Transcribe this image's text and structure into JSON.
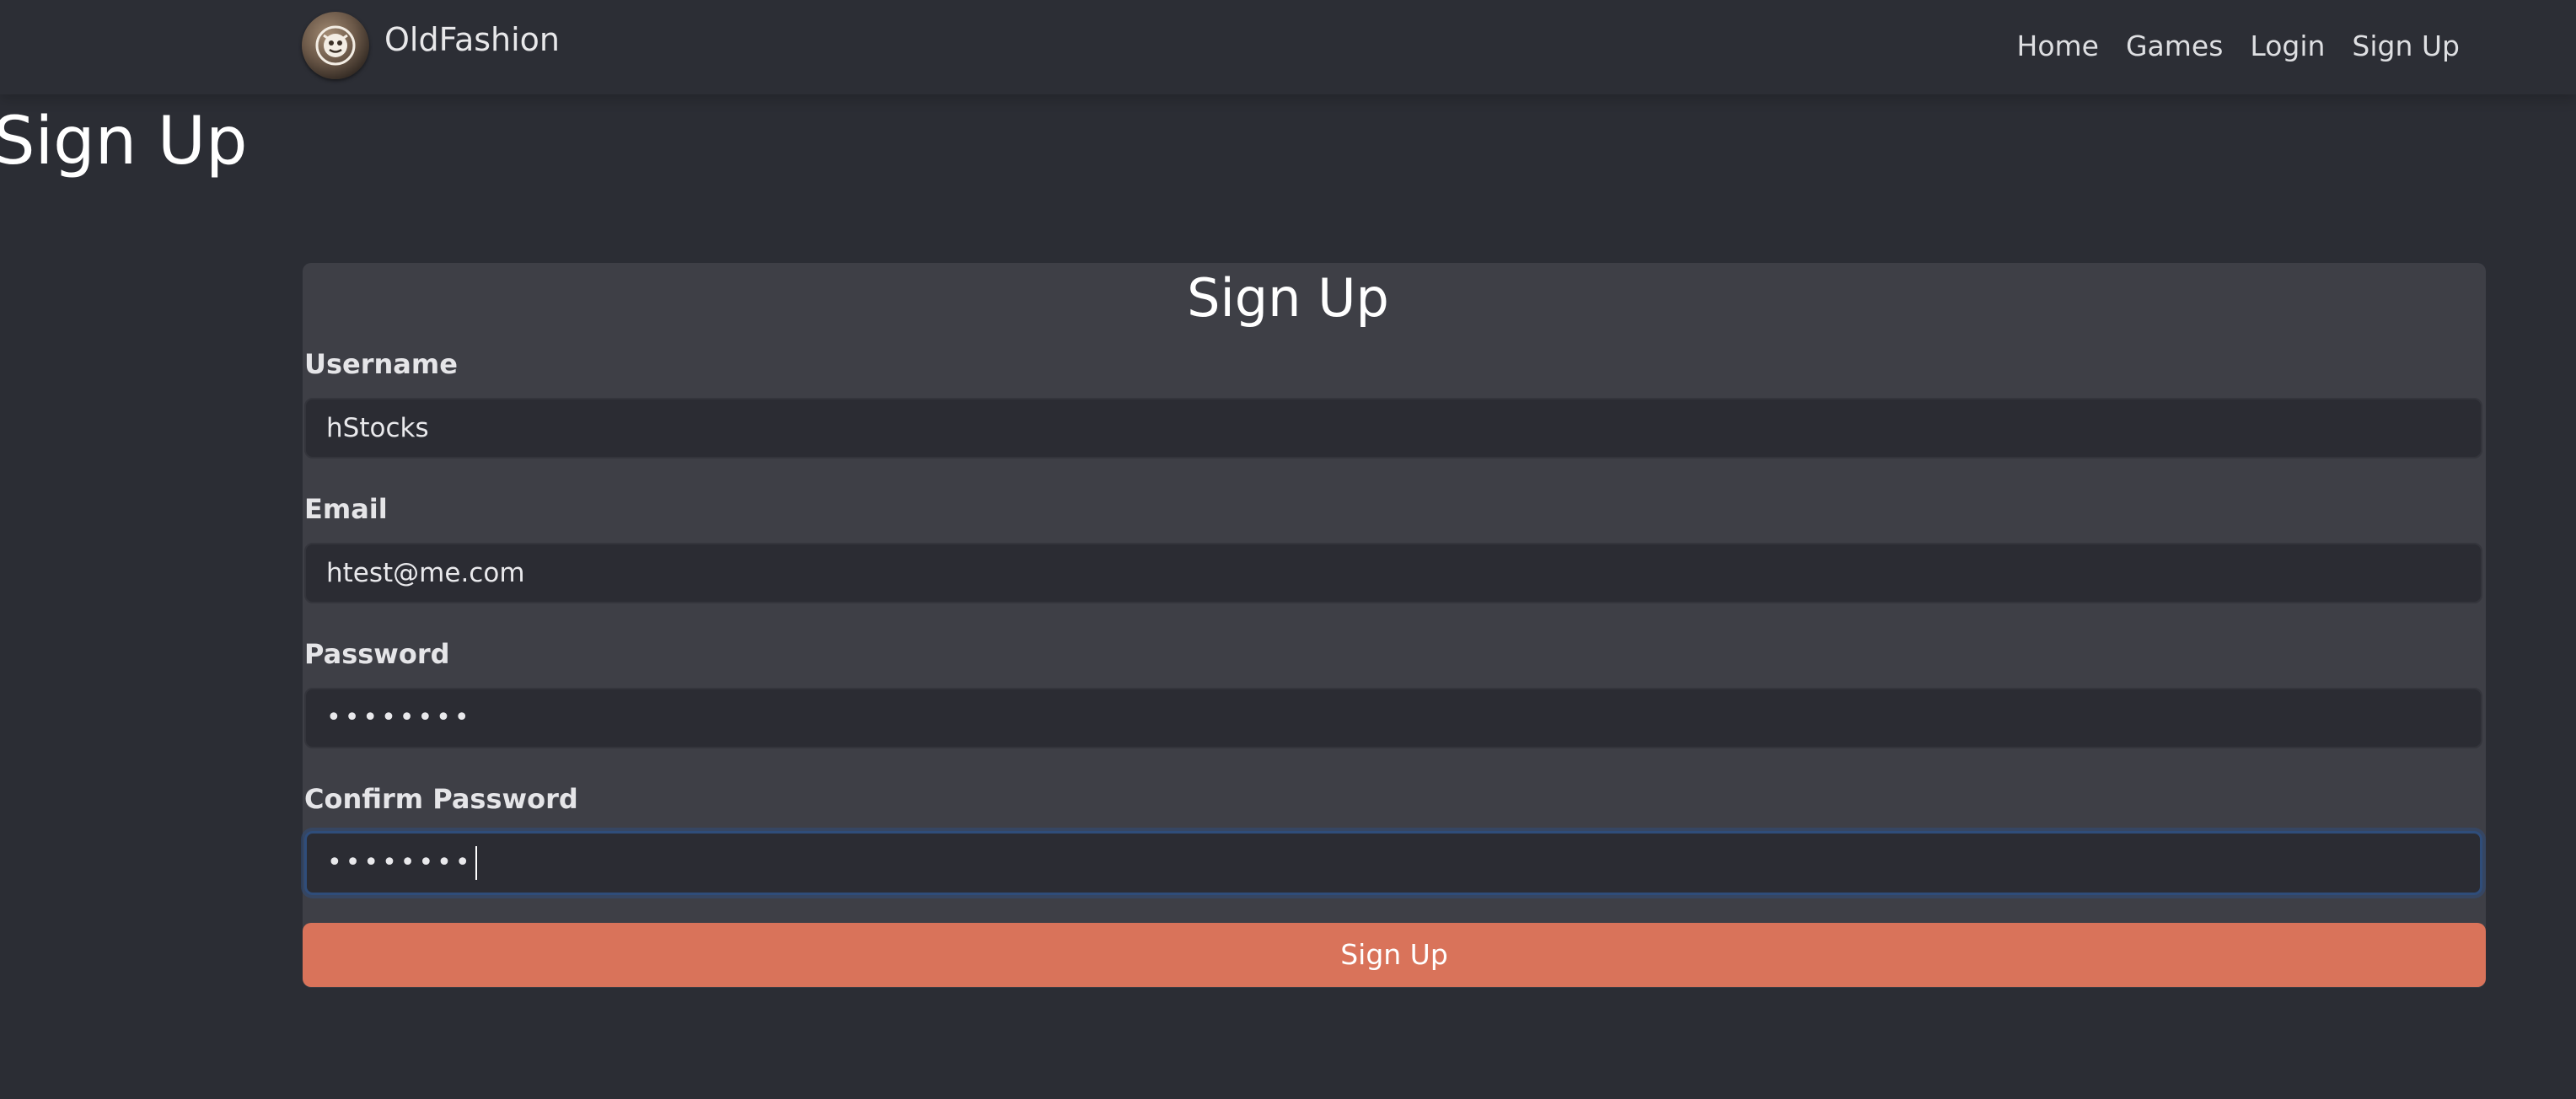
{
  "nav": {
    "brand": "OldFashion",
    "links": [
      "Home",
      "Games",
      "Login",
      "Sign Up"
    ]
  },
  "page": {
    "heading": "Sign Up"
  },
  "form": {
    "title": "Sign Up",
    "username": {
      "label": "Username",
      "value": "hStocks"
    },
    "email": {
      "label": "Email",
      "value": "htest@me.com"
    },
    "password": {
      "label": "Password",
      "value": "••••••••"
    },
    "confirm_password": {
      "label": "Confirm Password",
      "value": "••••••••"
    },
    "submit_label": "Sign Up"
  },
  "colors": {
    "background": "#2b2d34",
    "card": "#3e3f46",
    "input": "#2b2c33",
    "accent": "#d9735a",
    "focus_ring": "#2f4d7a"
  },
  "icons": {
    "brand_logo": "oldfashion-logo-icon"
  }
}
